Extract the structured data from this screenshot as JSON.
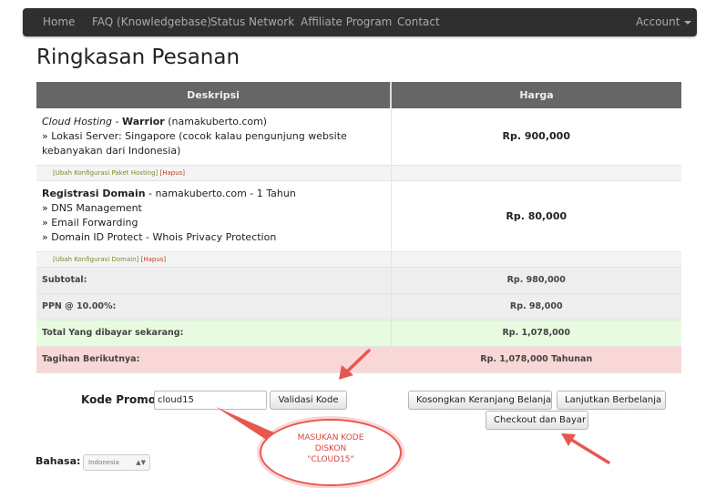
{
  "nav": {
    "items": [
      "Home",
      "FAQ (Knowledgebase)",
      "Status Network",
      "Affiliate Program",
      "Contact"
    ],
    "account": "Account"
  },
  "page_title": "Ringkasan Pesanan",
  "table": {
    "headers": {
      "description": "Deskripsi",
      "price": "Harga"
    },
    "item1": {
      "product_italic": "Cloud Hosting",
      "separator": " - ",
      "plan_bold": "Warrior",
      "domain": " (namakuberto.com)",
      "option": "» Lokasi Server: Singapore (cocok kalau pengunjung website kebanyakan dari Indonesia)",
      "price": "Rp. 900,000",
      "edit_link": "[Ubah Konfigurasi Paket Hosting]",
      "remove_link": "[Hapus]"
    },
    "item2": {
      "title_bold": "Registrasi Domain",
      "detail": " - namakuberto.com - 1 Tahun",
      "addons": [
        "» DNS Management",
        "» Email Forwarding",
        "» Domain ID Protect - Whois Privacy Protection"
      ],
      "price": "Rp. 80,000",
      "edit_link": "[Ubah Konfigurasi Domain]",
      "remove_link": "[Hapus]"
    },
    "subtotal": {
      "label": "Subtotal:",
      "value": "Rp. 980,000"
    },
    "tax": {
      "label": "PPN @ 10.00%:",
      "value": "Rp. 98,000"
    },
    "total": {
      "label": "Total Yang dibayar sekarang:",
      "value": "Rp. 1,078,000"
    },
    "recurring": {
      "label": "Tagihan Berikutnya:",
      "value": "Rp. 1,078,000 Tahunan"
    }
  },
  "promo": {
    "label": "Kode Promosi",
    "value": "cloud15",
    "validate_button": "Validasi Kode"
  },
  "actions": {
    "empty_cart": "Kosongkan Keranjang Belanja",
    "continue_shopping": "Lanjutkan Berbelanja",
    "checkout": "Checkout dan Bayar"
  },
  "language": {
    "label": "Bahasa:",
    "selected": "Indonesia"
  },
  "annotation": {
    "lines": [
      "MASUKAN KODE",
      "DISKON",
      "\"CLOUD15\""
    ]
  },
  "colors": {
    "navbar": "#2f2f2f",
    "table_header": "#666666",
    "total_row": "#e6fbdf",
    "recurring_row": "#f9d7d7",
    "annotation_red": "#e8574f"
  }
}
